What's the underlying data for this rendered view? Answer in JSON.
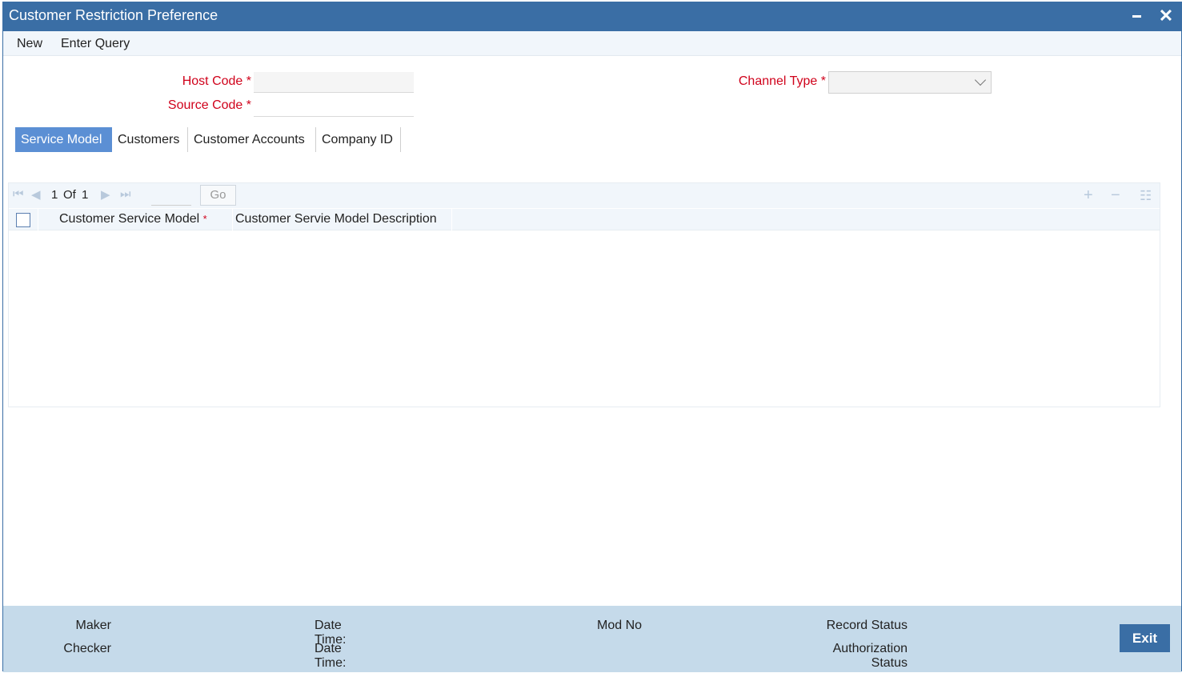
{
  "window": {
    "title": "Customer Restriction Preference"
  },
  "menu": {
    "new": "New",
    "enter_query": "Enter Query"
  },
  "form": {
    "host_code": {
      "label": "Host Code",
      "value": ""
    },
    "source_code": {
      "label": "Source Code",
      "value": ""
    },
    "channel_type": {
      "label": "Channel Type",
      "value": ""
    },
    "required_mark": "*"
  },
  "tabs": [
    {
      "label": "Service Model",
      "active": true
    },
    {
      "label": "Customers",
      "active": false
    },
    {
      "label": "Customer Accounts",
      "active": false
    },
    {
      "label": "Company ID",
      "active": false
    }
  ],
  "grid": {
    "pager": {
      "current": "1",
      "of_label": "Of",
      "total": "1",
      "go_label": "Go"
    },
    "columns": [
      "Customer Service Model",
      "Customer Servie Model Description"
    ],
    "required_mark": "*",
    "rows": []
  },
  "footer": {
    "maker": "Maker",
    "checker": "Checker",
    "date_time_1": "Date Time:",
    "date_time_2": "Date Time:",
    "mod_no": "Mod No",
    "record_status": "Record Status",
    "authorization_status_line1": "Authorization",
    "authorization_status_line2": "Status",
    "exit": "Exit"
  },
  "colors": {
    "title_bar": "#3a6ea5",
    "active_tab": "#5b8fd4",
    "required": "#d0021b",
    "footer": "#c5daea"
  }
}
